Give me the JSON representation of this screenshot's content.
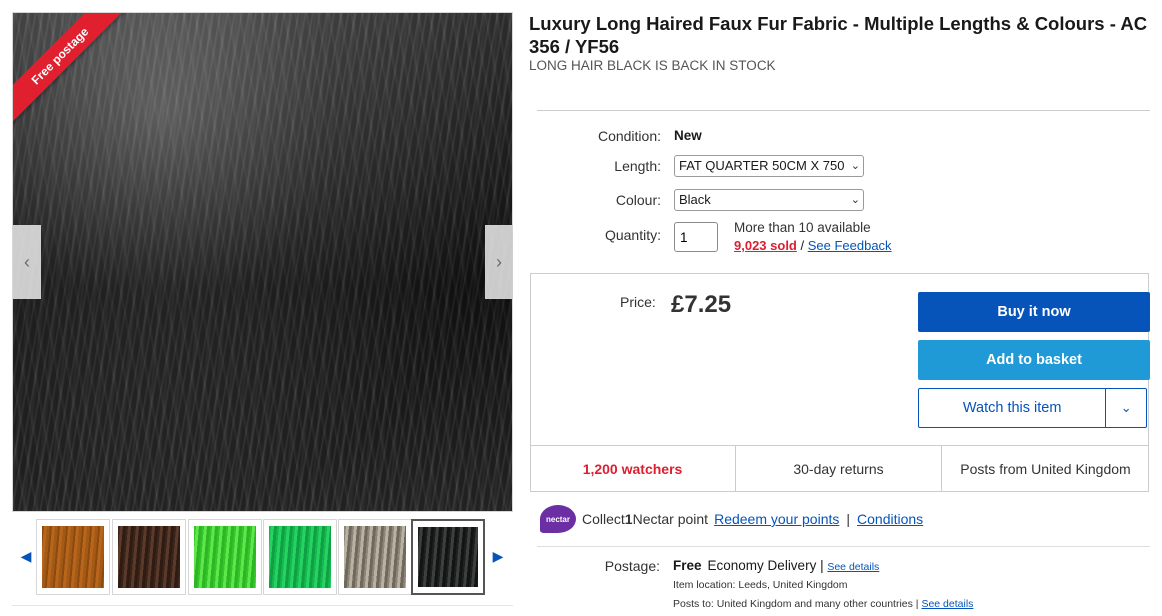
{
  "gallery": {
    "badge": "Free postage",
    "prev_arrow": "‹",
    "next_arrow": "›",
    "thumb_prev": "◀",
    "thumb_next": "▶",
    "thumbnails": [
      {
        "name": "brown-orange",
        "color": "#b9661c"
      },
      {
        "name": "dark-brown",
        "color": "#5b3a2b"
      },
      {
        "name": "lime-green",
        "color": "#5ee64a"
      },
      {
        "name": "green",
        "color": "#27d163"
      },
      {
        "name": "grey",
        "color": "#b9b1a1"
      },
      {
        "name": "black",
        "color": "#3b403d",
        "selected": true
      }
    ]
  },
  "item": {
    "title": "Luxury Long Haired Faux Fur Fabric - Multiple Lengths & Colours - AC 356 / YF56",
    "subtitle": "LONG HAIR BLACK IS BACK IN STOCK"
  },
  "details": {
    "condition_label": "Condition:",
    "condition_value": "New",
    "length_label": "Length:",
    "length_value": "FAT QUARTER 50CM X 750",
    "colour_label": "Colour:",
    "colour_value": "Black",
    "quantity_label": "Quantity:",
    "quantity_value": "1",
    "availability": "More than 10 available",
    "sold": "9,023 sold",
    "sold_sep": " / ",
    "feedback": "See Feedback"
  },
  "buy": {
    "price_label": "Price:",
    "price": "£7.25",
    "buy_now": "Buy it now",
    "add_to_basket": "Add to basket",
    "watch": "Watch this item",
    "watch_caret": "⌄"
  },
  "stats": {
    "watchers": "1,200 watchers",
    "returns": "30-day returns",
    "posts_from": "Posts from United Kingdom"
  },
  "nectar": {
    "logo": "nectar",
    "collect_prefix": "Collect ",
    "collect_count": "1",
    "collect_suffix": " Nectar point",
    "redeem": "Redeem your points",
    "sep": "|",
    "conditions": "Conditions"
  },
  "postage": {
    "label": "Postage:",
    "free": "Free",
    "method": "Economy Delivery",
    "sep": " | ",
    "see_details": "See details",
    "location": "Item location:  Leeds, United Kingdom",
    "posts_to": "Posts to:  United Kingdom and many other countries",
    "posts_to_sep": " | ",
    "posts_to_details": "See details"
  },
  "colors": {
    "primary_blue": "#0654ba",
    "basket_blue": "#1f9ad6",
    "alert_red": "#dd1e31",
    "nectar_purple": "#6b2fa3"
  }
}
